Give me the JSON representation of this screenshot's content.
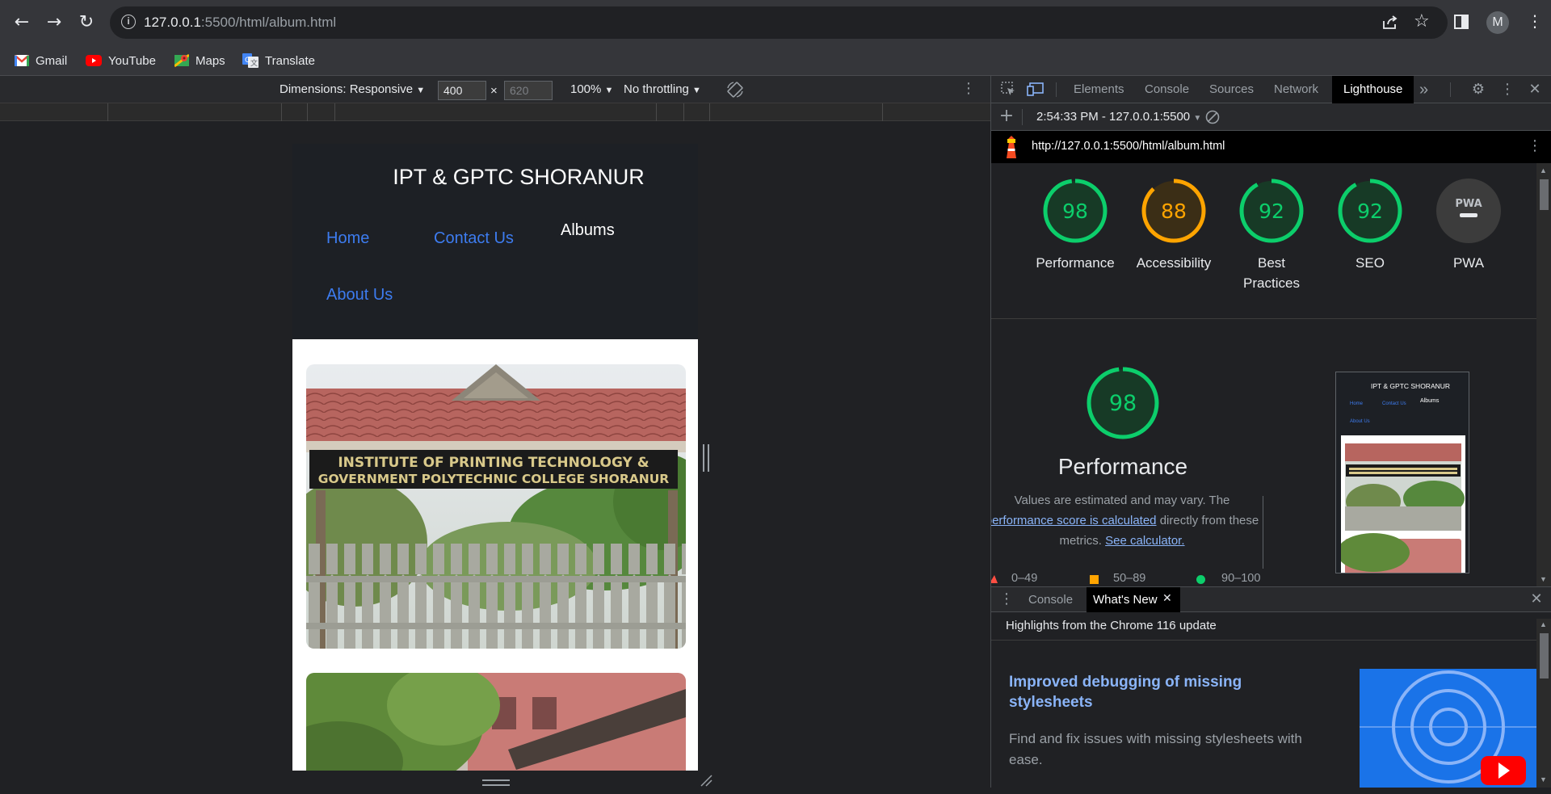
{
  "browser": {
    "url_host": "127.0.0.1",
    "url_path": ":5500/html/album.html",
    "profile_initial": "M",
    "bookmarks": [
      {
        "label": "Gmail",
        "color": "#ea4335"
      },
      {
        "label": "YouTube",
        "color": "#ff0000"
      },
      {
        "label": "Maps",
        "color": "#34a853"
      },
      {
        "label": "Translate",
        "color": "#4285f4"
      }
    ]
  },
  "device_toolbar": {
    "dimensions_label": "Dimensions: Responsive",
    "width": "400",
    "height_placeholder": "620",
    "times": "×",
    "zoom": "100%",
    "throttling": "No throttling"
  },
  "site": {
    "title": "IPT & GPTC SHORANUR",
    "nav": {
      "home": "Home",
      "contact": "Contact Us",
      "albums": "Albums",
      "about": "About Us"
    },
    "photo_sign_line1": "INSTITUTE OF PRINTING TECHNOLOGY &",
    "photo_sign_line2": "GOVERNMENT POLYTECHNIC COLLEGE SHORANUR"
  },
  "devtools": {
    "tabs": [
      "Elements",
      "Console",
      "Sources",
      "Network",
      "Lighthouse"
    ],
    "active_tab": "Lighthouse",
    "more_tabs": "»",
    "report_selector": "2:54:33 PM - 127.0.0.1:5500",
    "report_url": "http://127.0.0.1:5500/html/album.html",
    "scores": [
      {
        "value": "98",
        "label": "Performance",
        "color": "#0cce6b",
        "fraction": 0.98
      },
      {
        "value": "88",
        "label": "Accessibility",
        "color": "#ffa400",
        "fraction": 0.88
      },
      {
        "value": "92",
        "label": "Best Practices",
        "color": "#0cce6b",
        "fraction": 0.92
      },
      {
        "value": "92",
        "label": "SEO",
        "color": "#0cce6b",
        "fraction": 0.92
      }
    ],
    "pwa": {
      "badge": "PWA",
      "label": "PWA"
    },
    "performance": {
      "score": "98",
      "title": "Performance",
      "desc_start": "Values are estimated and may vary. The",
      "desc_link": "performance score is calculated",
      "desc_mid": "directly from these",
      "desc_end": "metrics.",
      "calc_link": "See calculator.",
      "legend": [
        "0–49",
        "50–89",
        "90–100"
      ]
    },
    "thumb": {
      "title": "IPT & GPTC SHORANUR",
      "home": "Home",
      "contact": "Contact Us",
      "albums": "Albums",
      "about": "About Us"
    },
    "drawer": {
      "tabs": [
        "Console",
        "What's New"
      ],
      "active_tab": "What's New",
      "highlights": "Highlights from the Chrome 116 update",
      "heading": "Improved debugging of missing stylesheets",
      "body": "Find and fix issues with missing stylesheets with ease."
    }
  }
}
